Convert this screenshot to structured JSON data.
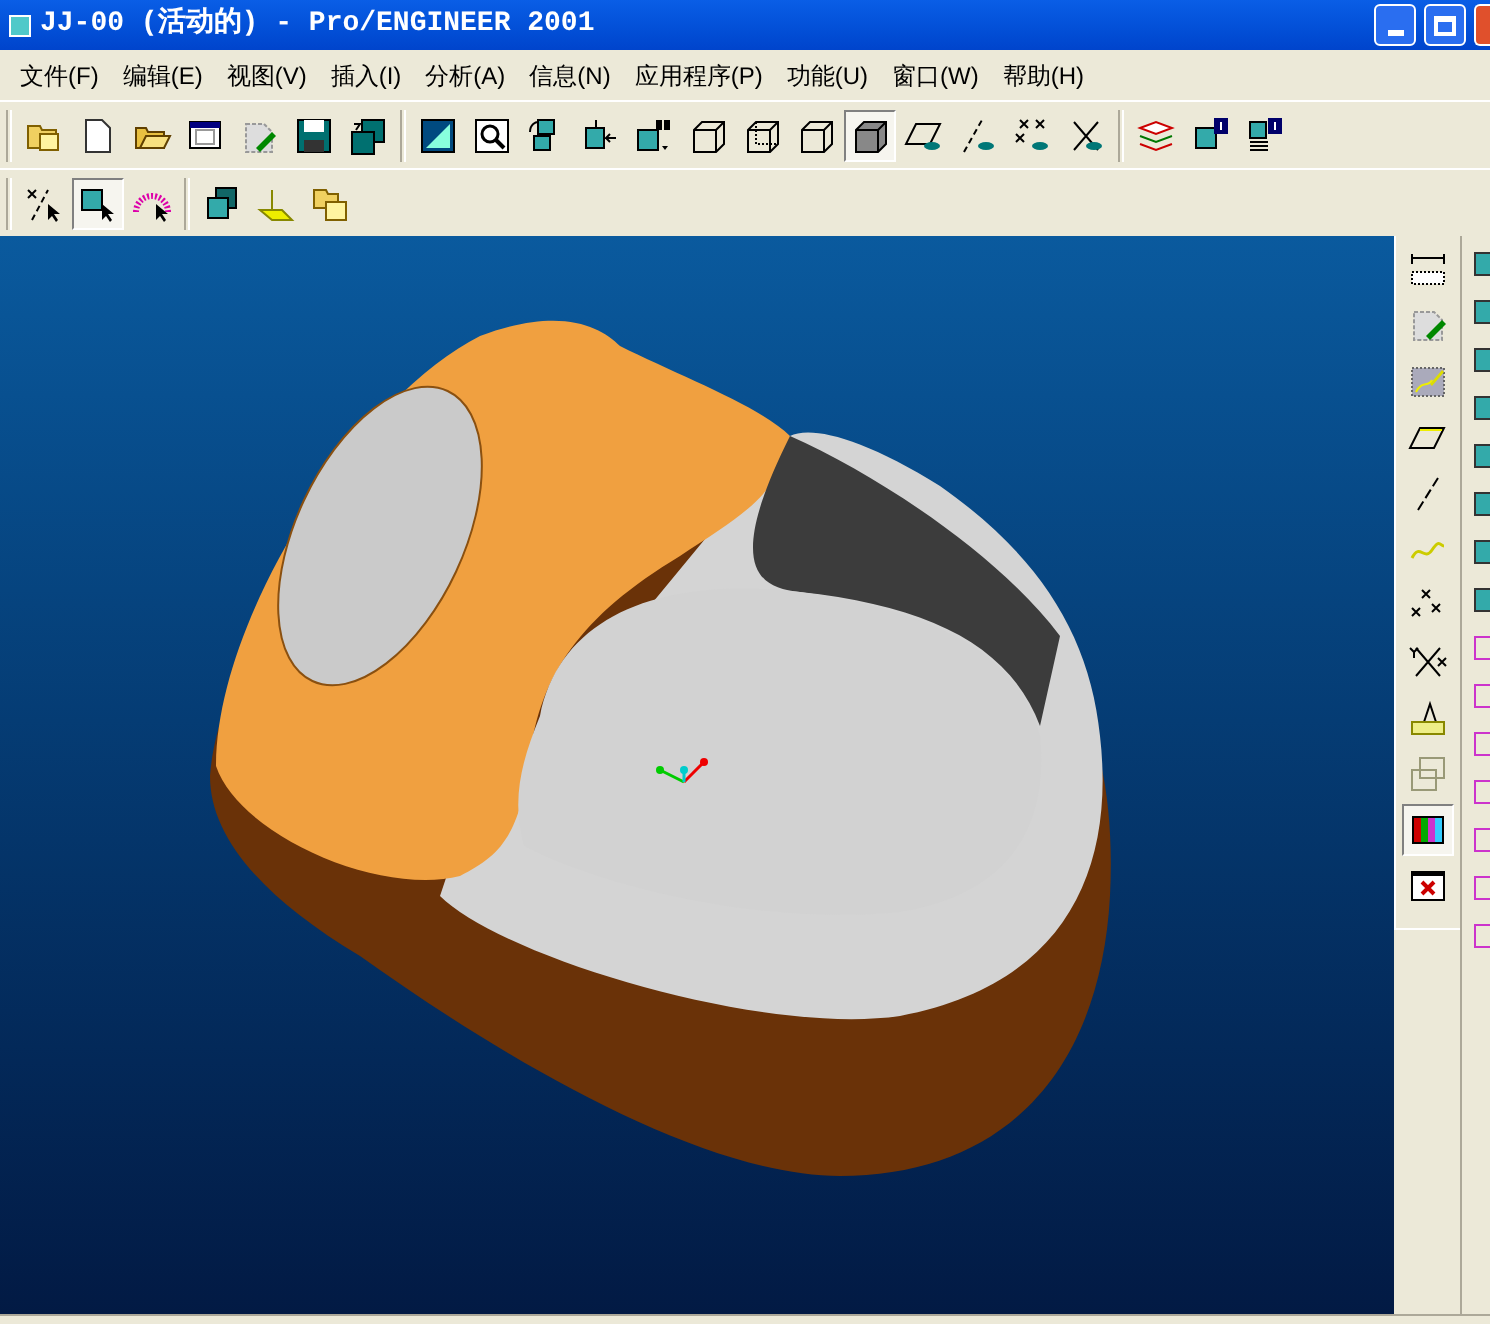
{
  "window": {
    "title": "JJ-00 (活动的) - Pro/ENGINEER 2001"
  },
  "menu": [
    {
      "label": "文件(F)"
    },
    {
      "label": "编辑(E)"
    },
    {
      "label": "视图(V)"
    },
    {
      "label": "插入(I)"
    },
    {
      "label": "分析(A)"
    },
    {
      "label": "信息(N)"
    },
    {
      "label": "应用程序(P)"
    },
    {
      "label": "功能(U)"
    },
    {
      "label": "窗口(W)"
    },
    {
      "label": "帮助(H)"
    }
  ],
  "top_toolbar": [
    [
      {
        "selected": false
      },
      {
        "selected": false
      },
      {
        "selected": false
      },
      {
        "selected": false
      },
      {
        "selected": false
      },
      {
        "selected": false
      },
      {
        "selected": false
      }
    ],
    [
      {
        "selected": false
      },
      {
        "selected": false
      },
      {
        "selected": false
      },
      {
        "selected": false
      },
      {
        "selected": false
      },
      {
        "selected": false
      },
      {
        "selected": false
      },
      {
        "selected": false
      },
      {
        "selected": true
      },
      {
        "selected": false
      },
      {
        "selected": false
      },
      {
        "selected": false
      },
      {
        "selected": false
      }
    ],
    [
      {
        "selected": false
      },
      {
        "selected": false
      },
      {
        "selected": false
      }
    ]
  ],
  "second_toolbar": [
    [
      {
        "selected": false
      },
      {
        "selected": true
      },
      {
        "selected": false
      }
    ],
    [
      {
        "selected": false
      },
      {
        "selected": false
      },
      {
        "selected": false
      }
    ]
  ],
  "right_toolbar": [
    {
      "selected": false
    },
    {
      "selected": false
    },
    {
      "selected": false
    },
    {
      "selected": false
    },
    {
      "selected": false
    },
    {
      "selected": false
    },
    {
      "selected": false
    },
    {
      "selected": false
    },
    {
      "selected": false
    },
    {
      "selected": false
    },
    {
      "selected": true
    },
    {
      "selected": false
    }
  ]
}
